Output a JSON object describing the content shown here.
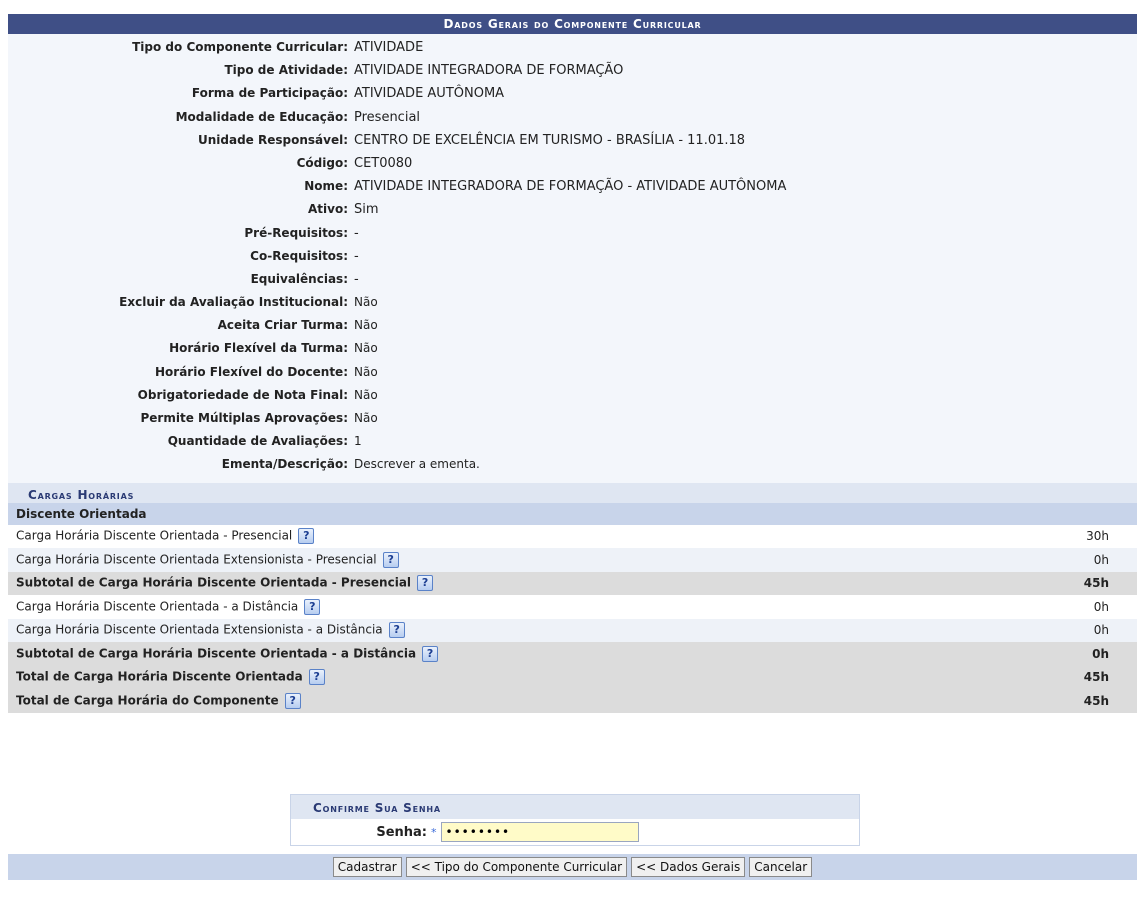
{
  "main": {
    "title": "Dados Gerais do Componente Curricular",
    "fields": [
      {
        "label": "Tipo do Componente Curricular:",
        "value": "ATIVIDADE"
      },
      {
        "label": "Tipo de Atividade:",
        "value": "ATIVIDADE INTEGRADORA DE FORMAÇÃO"
      },
      {
        "label": "Forma de Participação:",
        "value": "ATIVIDADE AUTÔNOMA"
      },
      {
        "label": "Modalidade de Educação:",
        "value": "Presencial"
      },
      {
        "label": "Unidade Responsável:",
        "value": "CENTRO DE EXCELÊNCIA EM TURISMO - BRASÍLIA - 11.01.18"
      },
      {
        "label": "Código:",
        "value": "CET0080"
      },
      {
        "label": "Nome:",
        "value": "ATIVIDADE INTEGRADORA DE FORMAÇÃO - ATIVIDADE AUTÔNOMA"
      },
      {
        "label": "Ativo:",
        "value": "Sim"
      },
      {
        "label": "Pré-Requisitos:",
        "value": "-"
      },
      {
        "label": "Co-Requisitos:",
        "value": "-"
      },
      {
        "label": "Equivalências:",
        "value": "-"
      },
      {
        "label": "Excluir da Avaliação Institucional:",
        "value": "Não"
      },
      {
        "label": "Aceita Criar Turma:",
        "value": "Não"
      },
      {
        "label": "Horário Flexível da Turma:",
        "value": "Não"
      },
      {
        "label": "Horário Flexível do Docente:",
        "value": "Não"
      },
      {
        "label": "Obrigatoriedade de Nota Final:",
        "value": "Não"
      },
      {
        "label": "Permite Múltiplas Aprovações:",
        "value": "Não"
      },
      {
        "label": "Quantidade de Avaliações:",
        "value": "1"
      },
      {
        "label": "Ementa/Descrição:",
        "value": "Descrever a ementa."
      }
    ]
  },
  "cargas": {
    "title": "Cargas Horárias",
    "subtitle": "Discente Orientada",
    "rows": [
      {
        "label": "Carga Horária Discente Orientada - Presencial",
        "value": "30h"
      },
      {
        "label": "Carga Horária Discente Orientada Extensionista - Presencial",
        "value": "0h"
      },
      {
        "label": "Subtotal de Carga Horária Discente Orientada - Presencial",
        "value": "45h"
      },
      {
        "label": "Carga Horária Discente Orientada - a Distância",
        "value": "0h"
      },
      {
        "label": "Carga Horária Discente Orientada Extensionista - a Distância",
        "value": "0h"
      },
      {
        "label": "Subtotal de Carga Horária Discente Orientada - a Distância",
        "value": "0h"
      },
      {
        "label": "Total de Carga Horária Discente Orientada",
        "value": "45h"
      },
      {
        "label": "Total de Carga Horária do Componente",
        "value": "45h"
      }
    ],
    "help_glyph": "?"
  },
  "password": {
    "title": "Confirme Sua Senha",
    "label": "Senha:",
    "required_mark": "*",
    "value": "••••••••"
  },
  "buttons": {
    "cadastrar": "Cadastrar",
    "tipo": "<< Tipo do Componente Curricular",
    "dados": "<< Dados Gerais",
    "cancelar": "Cancelar"
  },
  "icons": {
    "help": "help-icon",
    "required": "required-star-icon"
  }
}
